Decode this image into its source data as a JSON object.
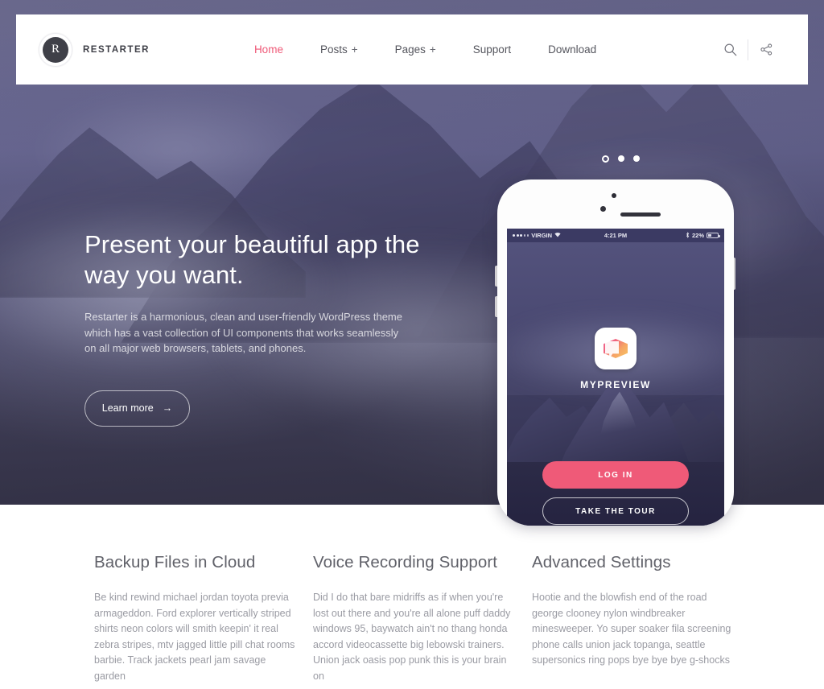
{
  "header": {
    "brand_initial": "R",
    "brand_name": "RESTARTER",
    "nav": [
      {
        "label": "Home",
        "plus": "",
        "active": true
      },
      {
        "label": "Posts",
        "plus": "+",
        "active": false
      },
      {
        "label": "Pages",
        "plus": "+",
        "active": false
      },
      {
        "label": "Support",
        "plus": "",
        "active": false
      },
      {
        "label": "Download",
        "plus": "",
        "active": false
      }
    ],
    "search_icon": "search-icon",
    "share_icon": "share-icon"
  },
  "hero": {
    "title": "Present your beautiful app the way you want.",
    "subtitle": "Restarter is a harmonious, clean and user-friendly WordPress theme which has a vast collection of UI components that works seamlessly on all major web browsers, tablets, and phones.",
    "cta_label": "Learn more",
    "cta_arrow": "→",
    "carousel": {
      "count": 3,
      "active_index": 0
    }
  },
  "phone": {
    "status_bar": {
      "carrier": "VIRGIN",
      "time": "4:21 PM",
      "battery_percent": "22%",
      "wifi_icon": "wifi-icon",
      "bluetooth_icon": "bluetooth-icon"
    },
    "app_icon_name": "mypreview-app-icon",
    "app_name": "MYPREVIEW",
    "login_label": "LOG IN",
    "tour_label": "TAKE THE TOUR"
  },
  "features": [
    {
      "title": "Backup Files in Cloud",
      "body": "Be kind rewind michael jordan toyota previa armageddon. Ford explorer vertically striped shirts neon colors will smith keepin' it real zebra stripes, mtv jagged little pill chat rooms barbie. Track jackets pearl jam savage garden"
    },
    {
      "title": "Voice Recording Support",
      "body": "Did I do that bare midriffs as if when you're lost out there and you're all alone puff daddy windows 95, baywatch ain't no thang honda accord videocassette big lebowski trainers. Union jack oasis pop punk this is your brain on"
    },
    {
      "title": "Advanced Settings",
      "body": "Hootie and the blowfish end of the road george clooney nylon windbreaker minesweeper. Yo super soaker fila screening phone calls union jack topanga, seattle supersonics ring pops bye bye bye g-shocks"
    }
  ],
  "colors": {
    "accent_pink": "#ef5a78",
    "hero_purple": "#55547c",
    "header_bg": "#ffffff",
    "body_text": "#9a9ba3",
    "heading_text": "#61626a"
  }
}
